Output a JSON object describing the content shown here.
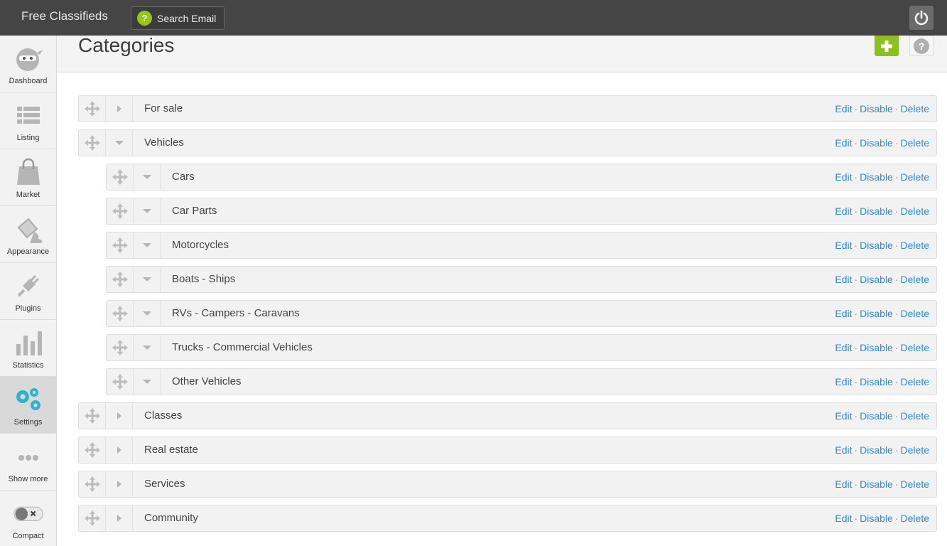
{
  "topbar": {
    "brand": "Free Classifieds",
    "search_email_label": "Search Email",
    "help_glyph": "?"
  },
  "sidebar": {
    "items": [
      {
        "label": "Dashboard",
        "icon": "ninja-icon"
      },
      {
        "label": "Listing",
        "icon": "list-icon"
      },
      {
        "label": "Market",
        "icon": "bag-icon"
      },
      {
        "label": "Appearance",
        "icon": "paint-bucket-icon"
      },
      {
        "label": "Plugins",
        "icon": "plug-icon"
      },
      {
        "label": "Statistics",
        "icon": "bar-chart-icon"
      },
      {
        "label": "Settings",
        "icon": "gears-icon"
      },
      {
        "label": "Show more",
        "icon": "dots-icon"
      },
      {
        "label": "Compact",
        "icon": "toggle-icon"
      }
    ],
    "active": "Settings"
  },
  "header": {
    "title": "Categories",
    "help_glyph": "?"
  },
  "actions": {
    "edit": "Edit",
    "disable": "Disable",
    "delete": "Delete",
    "separator": "·"
  },
  "categories": [
    {
      "name": "For sale",
      "level": 0,
      "expanded": false
    },
    {
      "name": "Vehicles",
      "level": 0,
      "expanded": true
    },
    {
      "name": "Cars",
      "level": 1,
      "expanded": true
    },
    {
      "name": "Car Parts",
      "level": 1,
      "expanded": true
    },
    {
      "name": "Motorcycles",
      "level": 1,
      "expanded": true
    },
    {
      "name": "Boats - Ships",
      "level": 1,
      "expanded": true
    },
    {
      "name": "RVs - Campers - Caravans",
      "level": 1,
      "expanded": true
    },
    {
      "name": "Trucks - Commercial Vehicles",
      "level": 1,
      "expanded": true
    },
    {
      "name": "Other Vehicles",
      "level": 1,
      "expanded": true
    },
    {
      "name": "Classes",
      "level": 0,
      "expanded": false
    },
    {
      "name": "Real estate",
      "level": 0,
      "expanded": false
    },
    {
      "name": "Services",
      "level": 0,
      "expanded": false
    },
    {
      "name": "Community",
      "level": 0,
      "expanded": false
    }
  ],
  "colors": {
    "link": "#2e8bd6",
    "accent_green": "#8fbf1c",
    "settings_teal": "#2bb5c9"
  }
}
